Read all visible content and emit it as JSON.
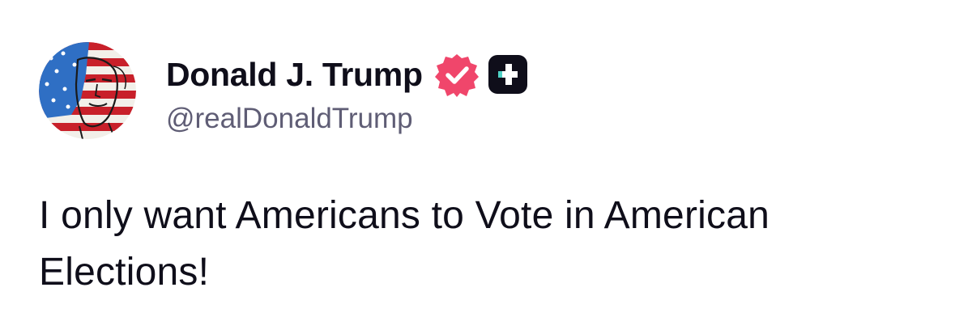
{
  "post": {
    "author": {
      "display_name": "Donald J. Trump",
      "handle": "@realDonaldTrump",
      "avatar_icon": "avatar-image",
      "verified_icon": "verified-badge-icon",
      "verified_color": "#f0466b",
      "plus_icon": "truth-plus-icon"
    },
    "text": "I only want Americans to Vote in American Elections!"
  },
  "colors": {
    "text": "#0f0e1a",
    "handle": "#5f5d75",
    "plus_badge_bg": "#0f0e1a",
    "plus_badge_accent": "#4fd1c5"
  }
}
